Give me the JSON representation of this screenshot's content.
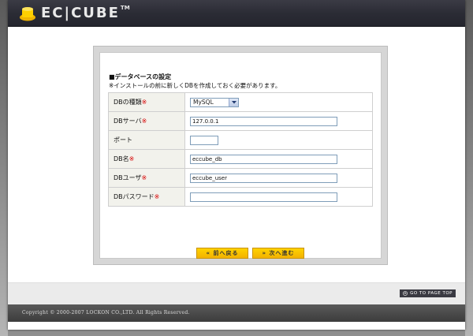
{
  "header": {
    "logo_text": "EC|CUBE",
    "logo_tm": "TM"
  },
  "section": {
    "title": "■データベースの設定",
    "notice": "※インストールの前に新しくDBを作成しておく必要があります。"
  },
  "form": {
    "rows": [
      {
        "label": "DBの種類",
        "required": "※",
        "type": "select",
        "value": "MySQL"
      },
      {
        "label": "DBサーバ",
        "required": "※",
        "type": "text",
        "value": "127.0.0.1"
      },
      {
        "label": "ポート",
        "required": "",
        "type": "text",
        "value": ""
      },
      {
        "label": "DB名",
        "required": "※",
        "type": "text",
        "value": "eccube_db"
      },
      {
        "label": "DBユーザ",
        "required": "※",
        "type": "text",
        "value": "eccube_user"
      },
      {
        "label": "DBパスワード",
        "required": "※",
        "type": "password",
        "value": ""
      }
    ]
  },
  "buttons": {
    "back": "« 前へ戻る",
    "next": "» 次へ進む"
  },
  "go_top": "GO TO PAGE TOP",
  "footer": {
    "copyright": "Copyright © 2000-2007 LOCKON CO.,LTD. All Rights Reserved."
  },
  "colors": {
    "header": "#2b2c35",
    "button": "#ffcc00",
    "required": "#d70000",
    "label_bg": "#f2f2ec"
  }
}
